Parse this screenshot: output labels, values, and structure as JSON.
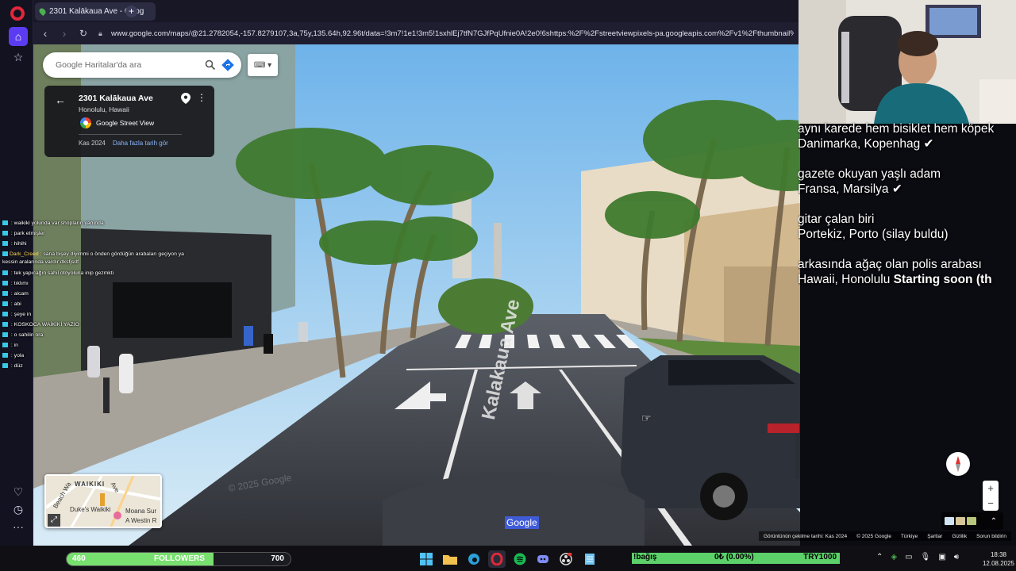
{
  "browser": {
    "tab_title": "2301 Kalākaua Ave - Goog",
    "url": "www.google.com/maps/@21.2782054,-157.8279107,3a,75y,135.64h,92.96t/data=!3m7!1e1!3m5!1sxhlEj7tfN7GJfPqUfnie0A!2e0!6shttps:%2F%2Fstreetviewpixels-pa.googleapis.com%2Fv1%2Fthumbnail%3Fcb_client%3Dmaps_sv.ta"
  },
  "maps": {
    "search_placeholder": "Google Haritalar'da ara",
    "location_title": "2301 Kalākaua Ave",
    "location_subtitle": "Honolulu, Hawaii",
    "source": "Google Street View",
    "capture_date": "Kas 2024",
    "more_dates": "Daha fazla tarih gör",
    "street_name": "Kalakaua Ave",
    "watermark": "© 2025 Google",
    "google_label": "Google",
    "minimap": {
      "labels": [
        "WAIKIKI",
        "Beach Wa",
        "Duke's Waikiki",
        "Moana Sur",
        "A Westin R",
        "Ave"
      ]
    },
    "footer": [
      "Görüntünün çekilme tarihi: Kas 2024",
      "© 2025 Google",
      "Türkiye",
      "Şartlar",
      "Gizlilik",
      "Sorun bildirin"
    ]
  },
  "chat": [
    {
      "user": "",
      "msg": "waikiki yolunda var shopların yanında"
    },
    {
      "user": "",
      "msg": "park etmişler"
    },
    {
      "user": "",
      "msg": "hihihi"
    },
    {
      "user": "Dark_Creed",
      "msg": "sana bişey diyimmi o önden gördüğün arabaları geçiyon ya"
    },
    {
      "user": "",
      "msg": "kessin aralarında vardır dksfjsdf"
    },
    {
      "user": "",
      "msg": "tek yapıcağın sahil otoyoluna inip gezmkti"
    },
    {
      "user": "",
      "msg": "tıklımı"
    },
    {
      "user": "",
      "msg": "alcam"
    },
    {
      "user": "",
      "msg": "abi"
    },
    {
      "user": "",
      "msg": "şeye in"
    },
    {
      "user": "",
      "msg": "KOSKOCA WAİKİKİ YAZIO"
    },
    {
      "user": "",
      "msg": "o sahilin ora"
    },
    {
      "user": "",
      "msg": "in"
    },
    {
      "user": "",
      "msg": "yola"
    },
    {
      "user": "",
      "msg": "düz"
    }
  ],
  "tasks": [
    "aynı karede hem bisiklet hem köpek",
    "Danimarka, Kopenhag ✔",
    "",
    "gazete okuyan yaşlı adam",
    "Fransa, Marsilya ✔",
    "",
    "gitar çalan biri",
    "Portekiz, Porto (silay buldu)",
    "",
    "arkasında ağaç olan polis arabası",
    "Hawaii, Honolulu"
  ],
  "tasks_tail": "Starting soon (th",
  "followers": {
    "label": "FOLLOWERS",
    "current": "460",
    "goal": "700",
    "fraction": 0.657
  },
  "donation": {
    "command": "!bağış",
    "progress": "0₺ (0.00%)",
    "goal": "TRY1000"
  },
  "clock": {
    "time": "18:38",
    "date": "12.08.2025"
  },
  "colors": {
    "accent": "#5b3cf2",
    "opera_red": "#e0283a",
    "followers_bar": "#78e06e",
    "donation_bar": "#5cd16a"
  }
}
